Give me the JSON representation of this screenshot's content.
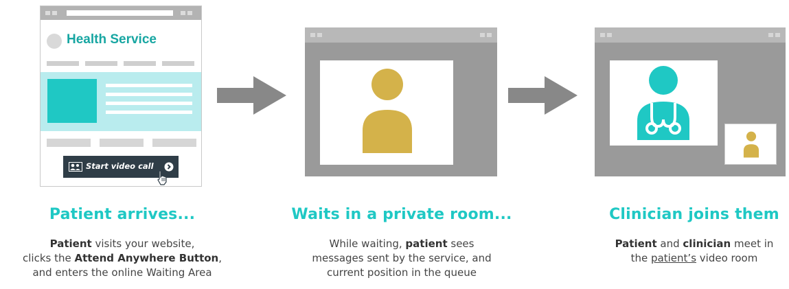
{
  "step1": {
    "site_title": "Health Service",
    "button_label": "Start video call",
    "heading": "Patient arrives...",
    "desc": [
      [
        {
          "t": "Patient",
          "b": true
        },
        {
          "t": " visits your website,"
        }
      ],
      [
        {
          "t": "clicks the "
        },
        {
          "t": "Attend Anywhere Button",
          "b": true
        },
        {
          "t": ","
        }
      ],
      [
        {
          "t": "and enters the online Waiting Area"
        }
      ]
    ]
  },
  "step2": {
    "heading": "Waits in a private room...",
    "desc": [
      [
        {
          "t": "While waiting, "
        },
        {
          "t": "patient",
          "b": true
        },
        {
          "t": " sees"
        }
      ],
      [
        {
          "t": "messages sent by the service, and"
        }
      ],
      [
        {
          "t": "current position in the queue"
        }
      ]
    ]
  },
  "step3": {
    "heading": "Clinician joins them",
    "desc": [
      [
        {
          "t": "Patient",
          "b": true
        },
        {
          "t": " and "
        },
        {
          "t": "clinician",
          "b": true
        },
        {
          "t": " meet in"
        }
      ],
      [
        {
          "t": "the "
        },
        {
          "t": "patient’s",
          "u": true
        },
        {
          "t": " video room"
        }
      ]
    ]
  },
  "colors": {
    "teal": "#1fc8c4",
    "gold": "#d4b24a",
    "window_gray": "#9a9a9a",
    "arrow_gray": "#888888"
  },
  "icons": [
    "browser-window",
    "patient-avatar-icon",
    "doctor-stethoscope-icon",
    "arrow-right-icon",
    "cursor-icon",
    "video-call-icon"
  ]
}
